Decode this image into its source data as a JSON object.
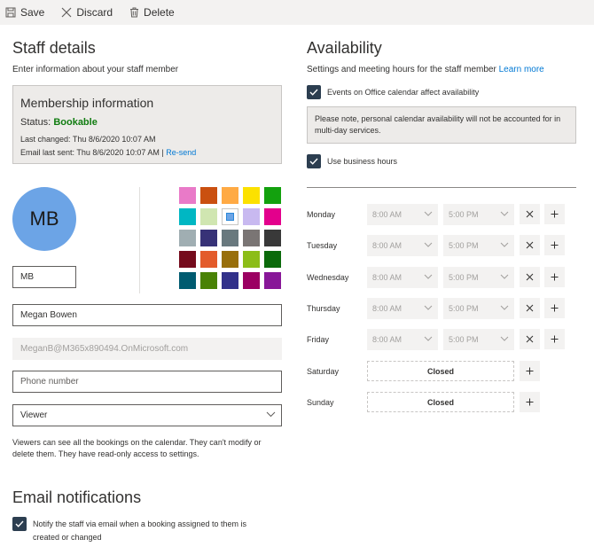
{
  "toolbar": {
    "save": "Save",
    "discard": "Discard",
    "delete": "Delete"
  },
  "staff": {
    "title": "Staff details",
    "subtitle": "Enter information about your staff member",
    "membership": {
      "title": "Membership information",
      "status_label": "Status:",
      "status_value": "Bookable",
      "last_changed": "Last changed: Thu 8/6/2020 10:07 AM",
      "email_last_sent": "Email last sent: Thu 8/6/2020 10:07 AM |",
      "resend": "Re-send"
    },
    "avatar_initials": "MB",
    "initials_value": "MB",
    "name_value": "Megan Bowen",
    "email_value": "MeganB@M365x890494.OnMicrosoft.com",
    "phone_placeholder": "Phone number",
    "role_value": "Viewer",
    "role_description": "Viewers can see all the bookings on the calendar. They can't modify or delete them. They have read-only access to settings.",
    "colors": [
      [
        "#e97ac8",
        "#ca5010",
        "#ffaa44",
        "#fce100",
        "#13a10e"
      ],
      [
        "#00b7c3",
        "#d0e6b1",
        "#6ca4e6",
        "#c8b9f0",
        "#e3008c"
      ],
      [
        "#a0aeb2",
        "#373277",
        "#69797e",
        "#7a7574",
        "#393939"
      ],
      [
        "#750b1c",
        "#e35b2b",
        "#986f0b",
        "#8cbd18",
        "#0b6a0b"
      ],
      [
        "#005b70",
        "#498205",
        "#32318a",
        "#9b0062",
        "#881798"
      ]
    ],
    "selected_color": "#6ca4e6"
  },
  "email_notifications": {
    "title": "Email notifications",
    "notify_label": "Notify the staff via email when a booking assigned to them is created or changed",
    "notify_checked": true
  },
  "availability": {
    "title": "Availability",
    "subtitle": "Settings and meeting hours for the staff member",
    "learn_more": "Learn more",
    "events_label": "Events on Office calendar affect availability",
    "note": "Please note, personal calendar availability will not be accounted for in multi-day services.",
    "business_hours_label": "Use business hours",
    "days": [
      {
        "name": "Monday",
        "start": "8:00 AM",
        "end": "5:00 PM"
      },
      {
        "name": "Tuesday",
        "start": "8:00 AM",
        "end": "5:00 PM"
      },
      {
        "name": "Wednesday",
        "start": "8:00 AM",
        "end": "5:00 PM"
      },
      {
        "name": "Thursday",
        "start": "8:00 AM",
        "end": "5:00 PM"
      },
      {
        "name": "Friday",
        "start": "8:00 AM",
        "end": "5:00 PM"
      },
      {
        "name": "Saturday",
        "closed": "Closed"
      },
      {
        "name": "Sunday",
        "closed": "Closed"
      }
    ]
  }
}
